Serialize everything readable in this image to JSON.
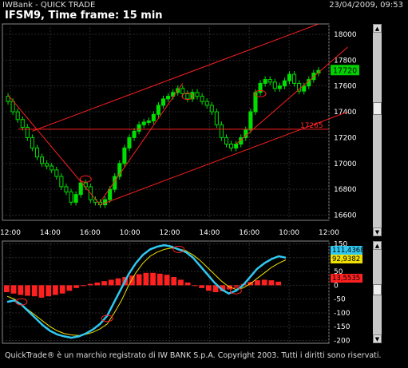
{
  "window": {
    "app_title": "IWBank - QUICK TRADE",
    "datetime": "23/04/2009, 09:53",
    "heading": "IFSM9, Time frame: 15 min",
    "footer": "QuickTrade® è un marchio registrato di IW BANK S.p.A. Copyright 2003. Tutti i diritti sono riservati."
  },
  "colors": {
    "background": "#000000",
    "grid": "#2a2a2a",
    "bull_candle": "#00e000",
    "trendline": "#ff2020",
    "fast_oscillator": "#30c8f0",
    "slow_oscillator": "#f0e000",
    "histogram": "#ff2020",
    "last_price_badge": "#00d000",
    "level_label": "#ff3030"
  },
  "chart_data": [
    {
      "type": "candlestick",
      "title": "IFSM9, Time frame: 15 min",
      "x_tick_labels": [
        "12:00",
        "14:00",
        "16:00",
        "10:00",
        "12:00",
        "14:00",
        "16:00",
        "10:00",
        "12:00"
      ],
      "y_tick_labels": [
        "16600",
        "16800",
        "17000",
        "17200",
        "17400",
        "17600",
        "17800",
        "18000"
      ],
      "ylim": [
        16560,
        18080
      ],
      "last_price": 17720,
      "level_line": {
        "value": 17265,
        "label": "17265"
      },
      "trendlines_note_values": [
        {
          "from": [
            0,
            17420
          ],
          "to": [
            26,
            16700
          ]
        },
        {
          "from": [
            5,
            17250
          ],
          "to": [
            30,
            16720
          ]
        }
      ],
      "closes": [
        17480,
        17400,
        17340,
        17280,
        17200,
        17120,
        17050,
        17000,
        16980,
        16950,
        16900,
        16820,
        16780,
        16700,
        16760,
        16850,
        16820,
        16720,
        16700,
        16680,
        16720,
        16800,
        16900,
        17000,
        17120,
        17200,
        17250,
        17300,
        17320,
        17330,
        17380,
        17450,
        17500,
        17520,
        17550,
        17580,
        17540,
        17500,
        17550,
        17520,
        17480,
        17450,
        17400,
        17300,
        17200,
        17150,
        17120,
        17150,
        17200,
        17260,
        17400,
        17550,
        17620,
        17650,
        17630,
        17580,
        17600,
        17640,
        17690,
        17620,
        17560,
        17600,
        17650,
        17700,
        17720
      ]
    },
    {
      "type": "line",
      "y_tick_labels": [
        "150",
        "100",
        "50",
        "0",
        "-50",
        "-100",
        "-150",
        "-200"
      ],
      "ylim": [
        -210,
        160
      ],
      "badges": [
        "111,4368",
        "92,9382",
        "13,5535"
      ],
      "series": [
        {
          "values": [
            -60,
            -55,
            -70,
            -95,
            -120,
            -145,
            -165,
            -178,
            -185,
            -190,
            -185,
            -175,
            -160,
            -140,
            -110,
            -60,
            -10,
            40,
            80,
            110,
            130,
            140,
            145,
            140,
            130,
            120,
            100,
            70,
            40,
            10,
            -15,
            -30,
            -20,
            0,
            30,
            60,
            80,
            95,
            105,
            100
          ]
        },
        {
          "values": [
            -40,
            -50,
            -70,
            -90,
            -110,
            -130,
            -150,
            -165,
            -175,
            -180,
            -182,
            -178,
            -170,
            -158,
            -140,
            -100,
            -55,
            0,
            45,
            80,
            105,
            120,
            130,
            135,
            132,
            125,
            110,
            90,
            65,
            40,
            15,
            -5,
            -15,
            -10,
            5,
            25,
            45,
            65,
            80,
            92
          ]
        },
        {
          "type": "bar",
          "values": [
            -25,
            -30,
            -35,
            -38,
            -40,
            -45,
            -40,
            -35,
            -30,
            -20,
            -10,
            0,
            5,
            10,
            15,
            20,
            25,
            30,
            35,
            40,
            45,
            45,
            42,
            38,
            30,
            20,
            10,
            0,
            -10,
            -20,
            -25,
            -22,
            -15,
            -5,
            5,
            12,
            18,
            20,
            18,
            13
          ]
        }
      ]
    }
  ]
}
